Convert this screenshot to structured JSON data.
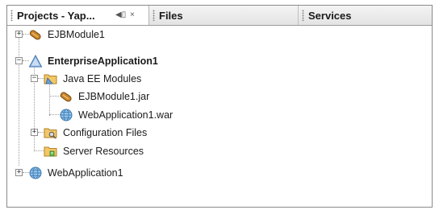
{
  "tabs": {
    "projects": "Projects - Yap...",
    "files": "Files",
    "services": "Services",
    "minimize_glyph": "◀▯",
    "close_glyph": "×"
  },
  "tree": {
    "ejb_module": "EJBModule1",
    "enterprise_app": "EnterpriseApplication1",
    "java_ee_modules": "Java EE Modules",
    "ejb_jar": "EJBModule1.jar",
    "web_war": "WebApplication1.war",
    "config_files": "Configuration Files",
    "server_resources": "Server Resources",
    "web_app": "WebApplication1"
  },
  "toggles": {
    "expanded": "−",
    "collapsed": "+"
  },
  "icons": {
    "ejb_module": "bean-icon",
    "enterprise_app": "triangle-icon",
    "java_ee_modules": "folder-modules-icon",
    "ejb_jar": "bean-icon",
    "web_war": "globe-icon",
    "config_files": "folder-config-icon",
    "server_resources": "folder-server-icon",
    "web_app": "globe-icon"
  }
}
